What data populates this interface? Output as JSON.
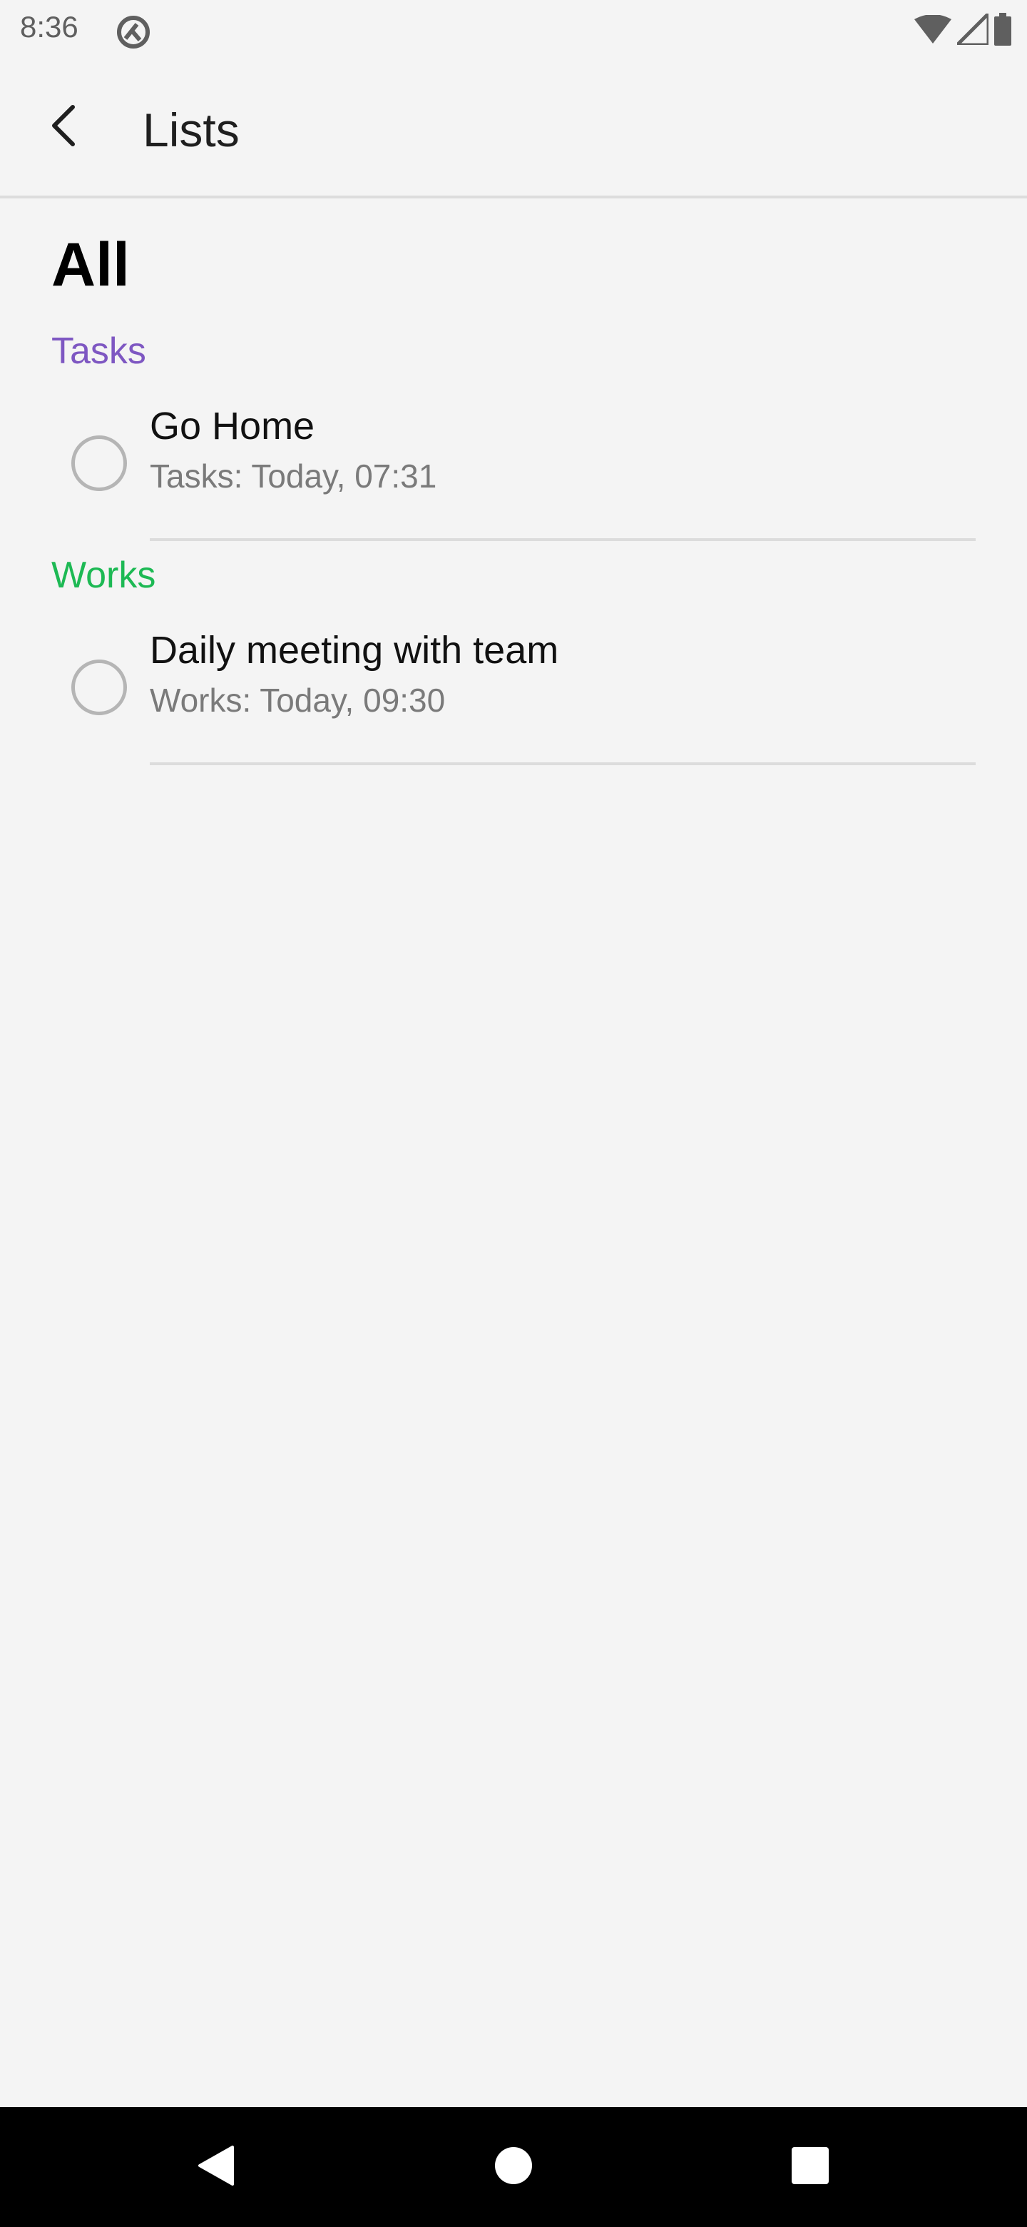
{
  "status_bar": {
    "time": "8:36",
    "icons": [
      "app-notification-icon",
      "wifi-icon",
      "cellular-icon",
      "battery-icon"
    ]
  },
  "app_bar": {
    "title": "Lists",
    "back_icon": "back-arrow-icon"
  },
  "main": {
    "heading": "All",
    "groups": [
      {
        "label": "Tasks",
        "color": "#7e57c2",
        "items": [
          {
            "title": "Go Home",
            "subtitle": "Tasks: Today, 07:31"
          }
        ]
      },
      {
        "label": "Works",
        "color": "#1db954",
        "items": [
          {
            "title": "Daily meeting with team",
            "subtitle": "Works: Today, 09:30"
          }
        ]
      }
    ]
  },
  "nav_bar": {
    "buttons": [
      "back-triangle-icon",
      "home-circle-icon",
      "recents-square-icon"
    ]
  }
}
